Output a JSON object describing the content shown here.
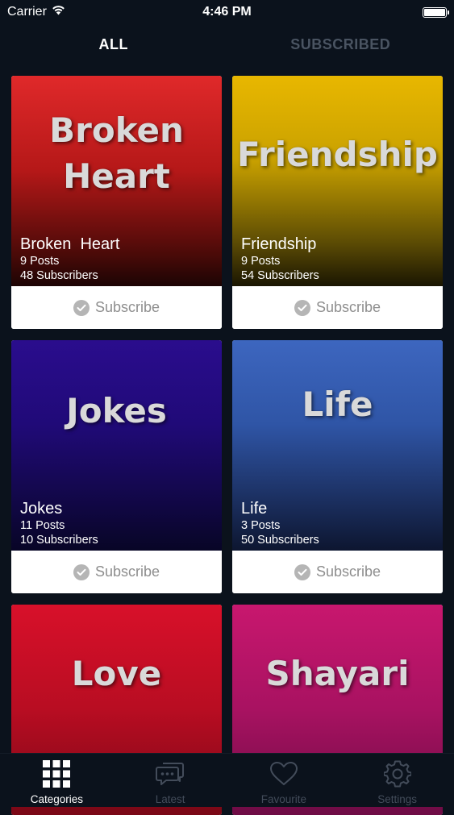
{
  "status_bar": {
    "carrier": "Carrier",
    "time": "4:46 PM"
  },
  "top_tabs": [
    {
      "label": "ALL",
      "active": true
    },
    {
      "label": "SUBSCRIBED",
      "active": false
    }
  ],
  "categories": [
    {
      "big_title_line1": "Broken",
      "big_title_line2": "Heart",
      "name": "Broken  Heart",
      "posts": "9 Posts",
      "subscribers": "48 Subscribers",
      "subscribe_label": "Subscribe",
      "color": "#e0292a"
    },
    {
      "big_title_line1": "Friendship",
      "big_title_line2": "",
      "name": "Friendship",
      "posts": "9 Posts",
      "subscribers": "54 Subscribers",
      "subscribe_label": "Subscribe",
      "color": "#e8b700"
    },
    {
      "big_title_line1": "Jokes",
      "big_title_line2": "",
      "name": "Jokes",
      "posts": "11 Posts",
      "subscribers": "10 Subscribers",
      "subscribe_label": "Subscribe",
      "color": "#2a0d8d"
    },
    {
      "big_title_line1": "Life",
      "big_title_line2": "",
      "name": "Life",
      "posts": "3 Posts",
      "subscribers": "50 Subscribers",
      "subscribe_label": "Subscribe",
      "color": "#3d66bf"
    },
    {
      "big_title_line1": "Love",
      "big_title_line2": "",
      "color": "#d8102a"
    },
    {
      "big_title_line1": "Shayari",
      "big_title_line2": "",
      "color": "#c8176e"
    }
  ],
  "bottom_tabs": [
    {
      "label": "Categories",
      "icon": "grid-icon",
      "active": true
    },
    {
      "label": "Latest",
      "icon": "chat-icon",
      "active": false
    },
    {
      "label": "Favourite",
      "icon": "heart-icon",
      "active": false
    },
    {
      "label": "Settings",
      "icon": "gear-icon",
      "active": false
    }
  ],
  "colors": {
    "background": "#0b121c",
    "inactive_tab": "#4a5462",
    "subscribe_text": "#8e8e8e"
  }
}
